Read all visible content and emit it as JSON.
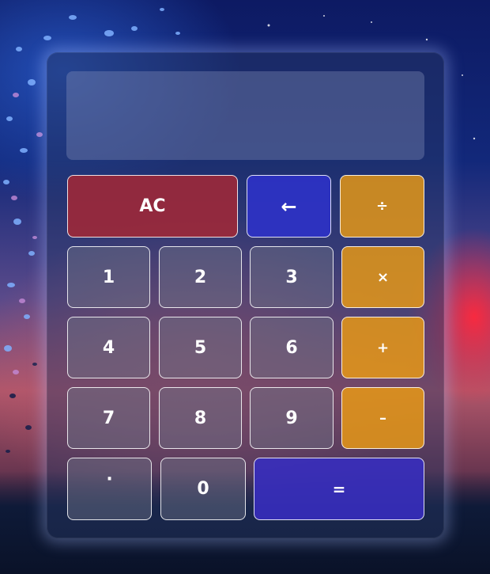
{
  "calculator": {
    "display_value": "",
    "keys": {
      "ac": "AC",
      "backspace": "←",
      "divide": "÷",
      "multiply": "×",
      "plus": "+",
      "minus": "–",
      "equals": "=",
      "decimal": "·",
      "d0": "0",
      "d1": "1",
      "d2": "2",
      "d3": "3",
      "d4": "4",
      "d5": "5",
      "d6": "6",
      "d7": "7",
      "d8": "8",
      "d9": "9"
    }
  },
  "colors": {
    "clear_key": "#a0283a",
    "backspace_key": "#2d32c8",
    "operator_key": "#eb9b14",
    "equals_key": "#372dbe",
    "digit_key": "#6e7387"
  }
}
